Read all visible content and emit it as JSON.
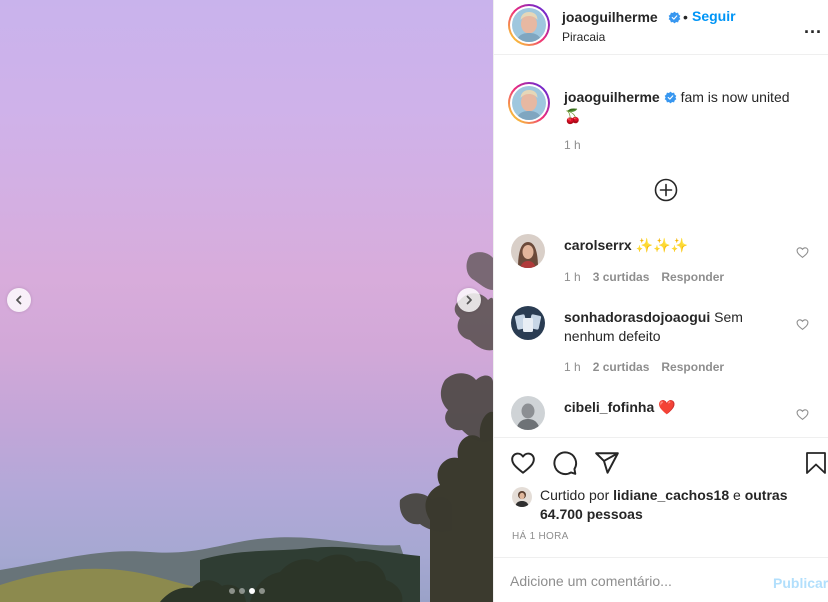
{
  "post": {
    "carousel": {
      "slide_count": 4,
      "active_index": 2
    },
    "author": {
      "username": "joaoguilherme",
      "verified": true,
      "location": "Piracaia"
    },
    "follow_label": "Seguir",
    "separator": "•",
    "more_label": "...",
    "caption": {
      "username": "joaoguilherme",
      "text": "fam is now united",
      "emoji": "🍒",
      "time": "1 h"
    },
    "comments": [
      {
        "username": "carolserrx",
        "text": "✨✨✨",
        "time": "1 h",
        "likes": "3 curtidas",
        "reply": "Responder"
      },
      {
        "username": "sonhadorasdojoaogui",
        "text": "Sem nenhum defeito",
        "time": "1 h",
        "likes": "2 curtidas",
        "reply": "Responder"
      },
      {
        "username": "cibeli_fofinha",
        "text": "❤️"
      }
    ],
    "likes": {
      "prefix": "Curtido por",
      "liker": "lidiane_cachos18",
      "connector": "e",
      "others": "outras 64.700 pessoas"
    },
    "posted_ago": "HÁ 1 HORA",
    "comment_box": {
      "placeholder": "Adicione um comentário...",
      "submit_label": "Publicar"
    }
  },
  "colors": {
    "accent": "#0095f6",
    "muted": "#8e8e8e",
    "text": "#262626",
    "submit_disabled": "#b2dffc"
  }
}
